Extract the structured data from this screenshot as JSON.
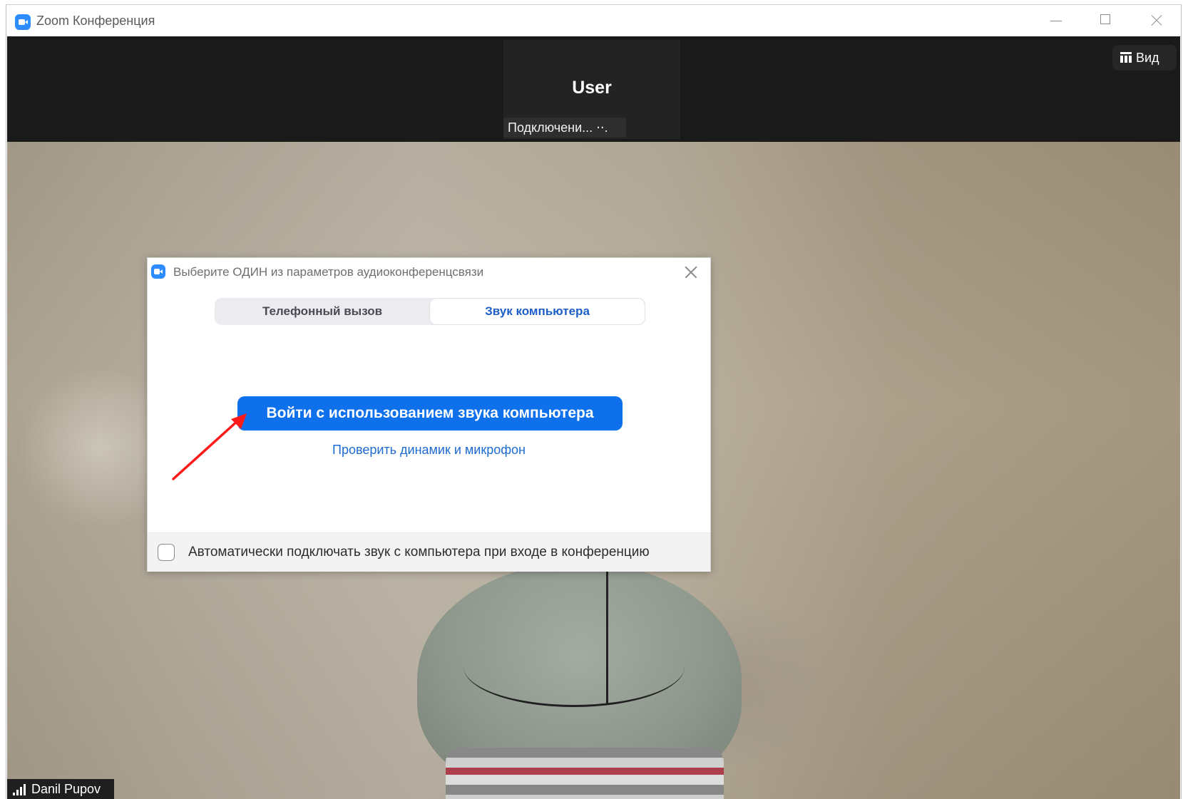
{
  "window": {
    "title": "Zoom Конференция",
    "icon": "zoom-camera-icon",
    "controls": [
      "minimize-icon",
      "maximize-icon",
      "close-icon"
    ]
  },
  "topbar": {
    "participant_name": "User",
    "participant_status": "Подключени... ⋅⋅.",
    "view_button_label": "Вид",
    "view_icon": "grid-view-icon"
  },
  "video": {
    "name_tag": "Danil Pupov",
    "signal_icon": "signal-strength-icon"
  },
  "dialog": {
    "title": "Выберите ОДИН из параметров аудиоконференцсвязи",
    "tabs": [
      {
        "label": "Телефонный вызов",
        "selected": false
      },
      {
        "label": "Звук компьютера",
        "selected": true
      }
    ],
    "join_button_label": "Войти с использованием звука компьютера",
    "test_link_label": "Проверить динамик и микрофон",
    "auto_connect_label": "Автоматически подключать звук с компьютера при входе в конференцию",
    "auto_connect_checked": false
  },
  "colors": {
    "zoom_blue": "#2d8cff",
    "button_blue": "#0e71eb",
    "annotation_arrow": "#ff1a1a"
  }
}
